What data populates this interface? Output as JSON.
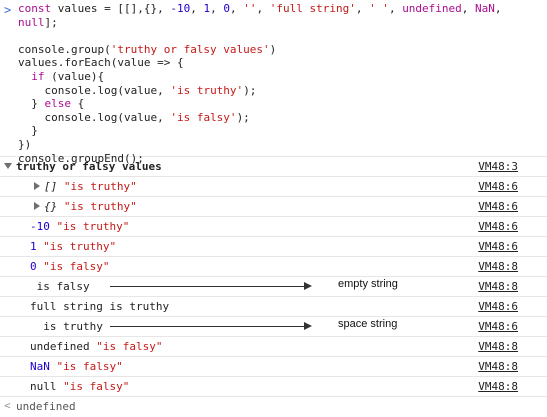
{
  "console_input": {
    "prompt": ">",
    "code": "const values = [[],{}, -10, 1, 0, '', 'full string', ' ', undefined, NaN,\nnull];\n\nconsole.group('truthy or falsy values')\nvalues.forEach(value => {\n  if (value){\n    console.log(value, 'is truthy');\n  } else {\n    console.log(value, 'is falsy');\n  }\n})\nconsole.groupEnd();"
  },
  "group": {
    "label": "truthy or falsy values",
    "source": "VM48:3"
  },
  "logs": [
    {
      "kind": "array",
      "value": "[]",
      "text": "\"is truthy\"",
      "source": "VM48:6"
    },
    {
      "kind": "object",
      "value": "{}",
      "text": "\"is truthy\"",
      "source": "VM48:6"
    },
    {
      "kind": "num",
      "value": "-10",
      "text": "\"is truthy\"",
      "source": "VM48:6"
    },
    {
      "kind": "num",
      "value": "1",
      "text": "\"is truthy\"",
      "source": "VM48:6"
    },
    {
      "kind": "num",
      "value": "0",
      "text": "\"is falsy\"",
      "source": "VM48:8"
    },
    {
      "kind": "plain",
      "value": "",
      "text": " is falsy",
      "source": "VM48:8"
    },
    {
      "kind": "plain",
      "value": "",
      "text": "full string is truthy",
      "source": "VM48:6"
    },
    {
      "kind": "plain",
      "value": "",
      "text": "  is truthy",
      "source": "VM48:6"
    },
    {
      "kind": "undef",
      "value": "undefined",
      "text": "\"is falsy\"",
      "source": "VM48:8"
    },
    {
      "kind": "num",
      "value": "NaN",
      "text": "\"is falsy\"",
      "source": "VM48:8"
    },
    {
      "kind": "undef",
      "value": "null",
      "text": "\"is falsy\"",
      "source": "VM48:8"
    }
  ],
  "annotations": [
    {
      "row": 5,
      "label": "empty string"
    },
    {
      "row": 7,
      "label": "space string"
    }
  ],
  "result": {
    "prefix": "<",
    "value": "undefined"
  },
  "colors": {
    "number": "#1c00cf",
    "string": "#c41a16",
    "keyword": "#aa0d91",
    "prompt": "#3b6fd6"
  }
}
